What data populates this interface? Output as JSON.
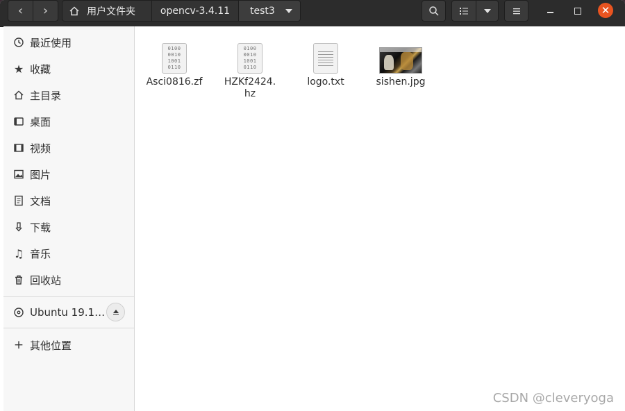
{
  "header": {
    "breadcrumbs": [
      "用户文件夹",
      "opencv-3.4.11",
      "test3"
    ]
  },
  "sidebar": {
    "items": [
      {
        "label": "最近使用",
        "icon": "clock-icon"
      },
      {
        "label": "收藏",
        "icon": "star-icon"
      },
      {
        "label": "主目录",
        "icon": "home-icon"
      },
      {
        "label": "桌面",
        "icon": "desktop-icon"
      },
      {
        "label": "视频",
        "icon": "video-icon"
      },
      {
        "label": "图片",
        "icon": "picture-icon"
      },
      {
        "label": "文档",
        "icon": "document-icon"
      },
      {
        "label": "下载",
        "icon": "download-icon"
      },
      {
        "label": "音乐",
        "icon": "music-icon"
      },
      {
        "label": "回收站",
        "icon": "trash-icon"
      }
    ],
    "device": {
      "label": "Ubuntu 19.1…",
      "icon": "disc-icon"
    },
    "other": {
      "label": "其他位置",
      "icon": "plus-icon"
    }
  },
  "files": [
    {
      "name": "Asci0816.zf",
      "type": "binary",
      "icon": "binary-file-icon",
      "bits": [
        "0100",
        "0010",
        "1001",
        "0110"
      ]
    },
    {
      "name": "HZKf2424.\nhz",
      "type": "binary",
      "icon": "binary-file-icon",
      "bits": [
        "0100",
        "0010",
        "1001",
        "0110"
      ]
    },
    {
      "name": "logo.txt",
      "type": "text",
      "icon": "text-file-icon"
    },
    {
      "name": "sishen.jpg",
      "type": "image",
      "icon": "image-thumbnail"
    }
  ],
  "watermark": "CSDN @cleveryoga",
  "colors": {
    "close_button": "#e95420",
    "headerbar": "#2c2c2c",
    "sidebar": "#f7f7f7"
  }
}
